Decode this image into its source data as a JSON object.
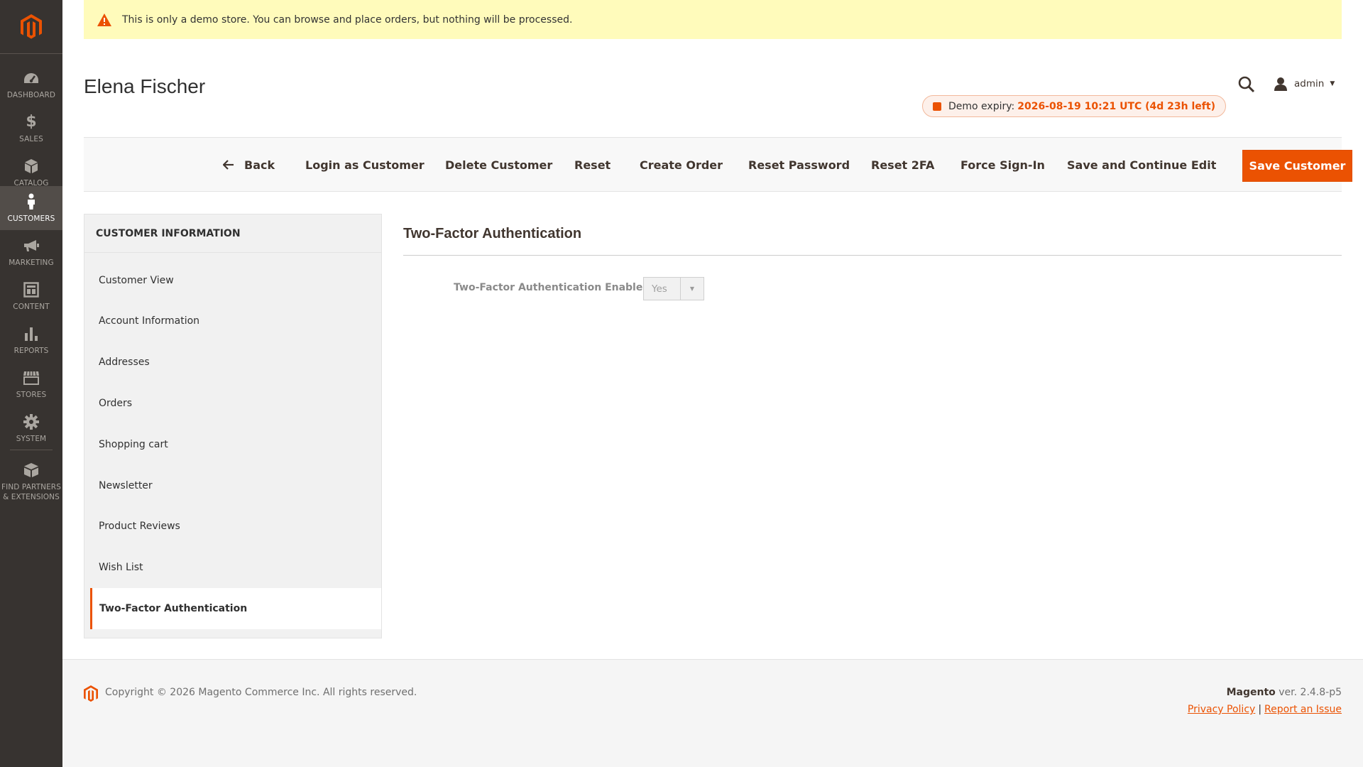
{
  "sidebar": {
    "items": [
      {
        "label": "Dashboard",
        "icon": "dashboard-icon"
      },
      {
        "label": "Sales",
        "icon": "dollar-icon"
      },
      {
        "label": "Catalog",
        "icon": "cube-icon"
      },
      {
        "label": "Customers",
        "icon": "person-icon",
        "active": true
      },
      {
        "label": "Marketing",
        "icon": "megaphone-icon"
      },
      {
        "label": "Content",
        "icon": "layout-icon"
      },
      {
        "label": "Reports",
        "icon": "bar-chart-icon"
      },
      {
        "label": "Stores",
        "icon": "storefront-icon"
      },
      {
        "label": "System",
        "icon": "gear-icon"
      },
      {
        "label": "Find Partners & Extensions",
        "icon": "box-icon"
      }
    ]
  },
  "notice": {
    "text": "This is only a demo store. You can browse and place orders, but nothing will be processed."
  },
  "header": {
    "title": "Elena Fischer",
    "user": "admin",
    "expiry_label": "Demo expiry:",
    "expiry_value": "2026-08-19 10:21 UTC (4d 23h left)"
  },
  "toolbar": {
    "back": "Back",
    "login_as_customer": "Login as Customer",
    "delete_customer": "Delete Customer",
    "reset": "Reset",
    "create_order": "Create Order",
    "reset_password": "Reset Password",
    "reset_2fa": "Reset 2FA",
    "force_sign_in": "Force Sign-In",
    "save_continue": "Save and Continue Edit",
    "save_customer": "Save Customer"
  },
  "tabs": {
    "heading": "Customer Information",
    "items": [
      "Customer View",
      "Account Information",
      "Addresses",
      "Orders",
      "Shopping cart",
      "Newsletter",
      "Product Reviews",
      "Wish List",
      "Two-Factor Authentication"
    ],
    "active": "Two-Factor Authentication"
  },
  "content": {
    "section_title": "Two-Factor Authentication",
    "field_label": "Two-Factor Authentication Enabled",
    "field_value": "Yes"
  },
  "footer": {
    "copyright": "Copyright © 2026 Magento Commerce Inc. All rights reserved.",
    "brand": "Magento",
    "version": " ver. 2.4.8-p5",
    "privacy": "Privacy Policy",
    "separator": "|",
    "report": "Report an Issue"
  },
  "colors": {
    "accent": "#eb5202",
    "sidebar_bg": "#373330",
    "notice_bg": "#fffbbb"
  }
}
